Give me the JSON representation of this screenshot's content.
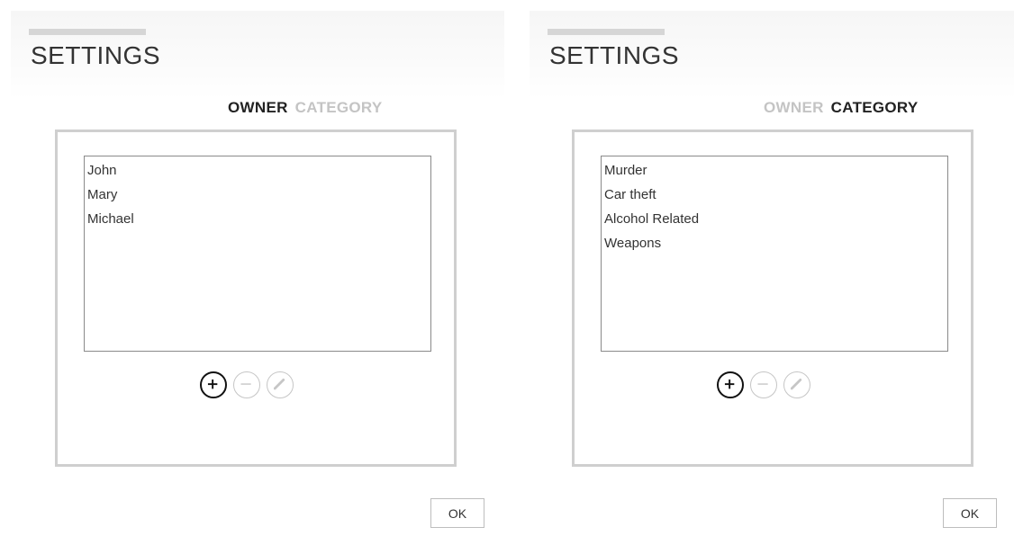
{
  "left_panel": {
    "title": "SETTINGS",
    "tabs": [
      {
        "label": "OWNER",
        "active": true
      },
      {
        "label": "CATEGORY",
        "active": false
      }
    ],
    "list_items": [
      "John",
      "Mary",
      "Michael"
    ],
    "buttons": [
      {
        "icon": "plus-icon",
        "enabled": true
      },
      {
        "icon": "minus-icon",
        "enabled": false
      },
      {
        "icon": "pencil-icon",
        "enabled": false
      }
    ],
    "ok_label": "OK"
  },
  "right_panel": {
    "title": "SETTINGS",
    "tabs": [
      {
        "label": "OWNER",
        "active": false
      },
      {
        "label": "CATEGORY",
        "active": true
      }
    ],
    "list_items": [
      "Murder",
      "Car theft",
      "Alcohol Related",
      "Weapons"
    ],
    "buttons": [
      {
        "icon": "plus-icon",
        "enabled": true
      },
      {
        "icon": "minus-icon",
        "enabled": false
      },
      {
        "icon": "pencil-icon",
        "enabled": false
      }
    ],
    "ok_label": "OK"
  },
  "colors": {
    "active_tab": "#222222",
    "inactive_tab": "#c4c4c4",
    "frame_border": "#cfcfcf",
    "listbox_border": "#8a8a8a"
  }
}
